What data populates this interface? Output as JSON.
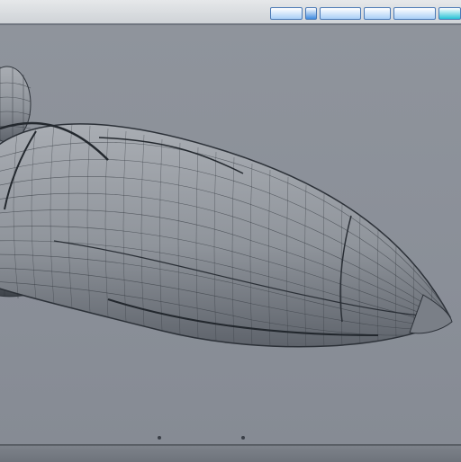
{
  "window": {
    "accent_color": "#4a79b5",
    "background_color": "#8f939b"
  },
  "toolbar": {
    "icons": [
      "toolbar-button",
      "toolbar-button",
      "toolbar-button",
      "toolbar-button",
      "toolbar-button",
      "toolbar-button"
    ]
  },
  "viewport": {
    "content": "wireframe-rocket-model"
  }
}
